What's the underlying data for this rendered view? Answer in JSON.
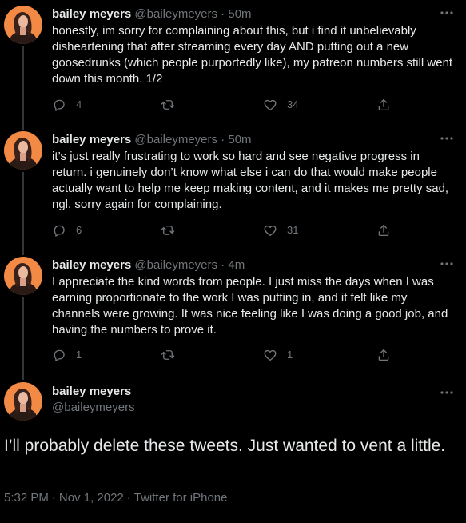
{
  "author": {
    "name": "bailey meyers",
    "handle": "@baileymeyers"
  },
  "thread": [
    {
      "time": "50m",
      "text": "honestly, im sorry for complaining about this, but i find it unbelievably disheartening that after streaming every day AND putting out a new goosedrunks (which people purportedly like), my patreon numbers still went down this month. 1/2",
      "replies": "4",
      "retweets": "",
      "likes": "34"
    },
    {
      "time": "50m",
      "text": "it’s just really frustrating to work so hard and see negative progress in return. i genuinely don’t know what else i can do that would make people actually want to help me keep making content, and it makes me pretty sad, ngl. sorry again for complaining.",
      "replies": "6",
      "retweets": "",
      "likes": "31"
    },
    {
      "time": "4m",
      "text": "I appreciate the kind words from people. I just miss the days when I was earning proportionate to the work I was putting in, and it felt like my channels were growing. It was nice feeling like I was doing a good job, and having the numbers to prove it.",
      "replies": "1",
      "retweets": "",
      "likes": "1"
    }
  ],
  "main_tweet": {
    "text": "I’ll probably delete these tweets. Just wanted to vent a little.",
    "time": "5:32 PM",
    "date": "Nov 1, 2022",
    "separator": "·",
    "source": "Twitter for iPhone"
  },
  "dot_sep": " · ",
  "icons": [
    "more-icon",
    "reply-icon",
    "retweet-icon",
    "like-icon",
    "share-icon"
  ],
  "colors": {
    "background": "#000000",
    "text": "#e7e9ea",
    "secondary": "#71767b",
    "thread_line": "#333639"
  }
}
